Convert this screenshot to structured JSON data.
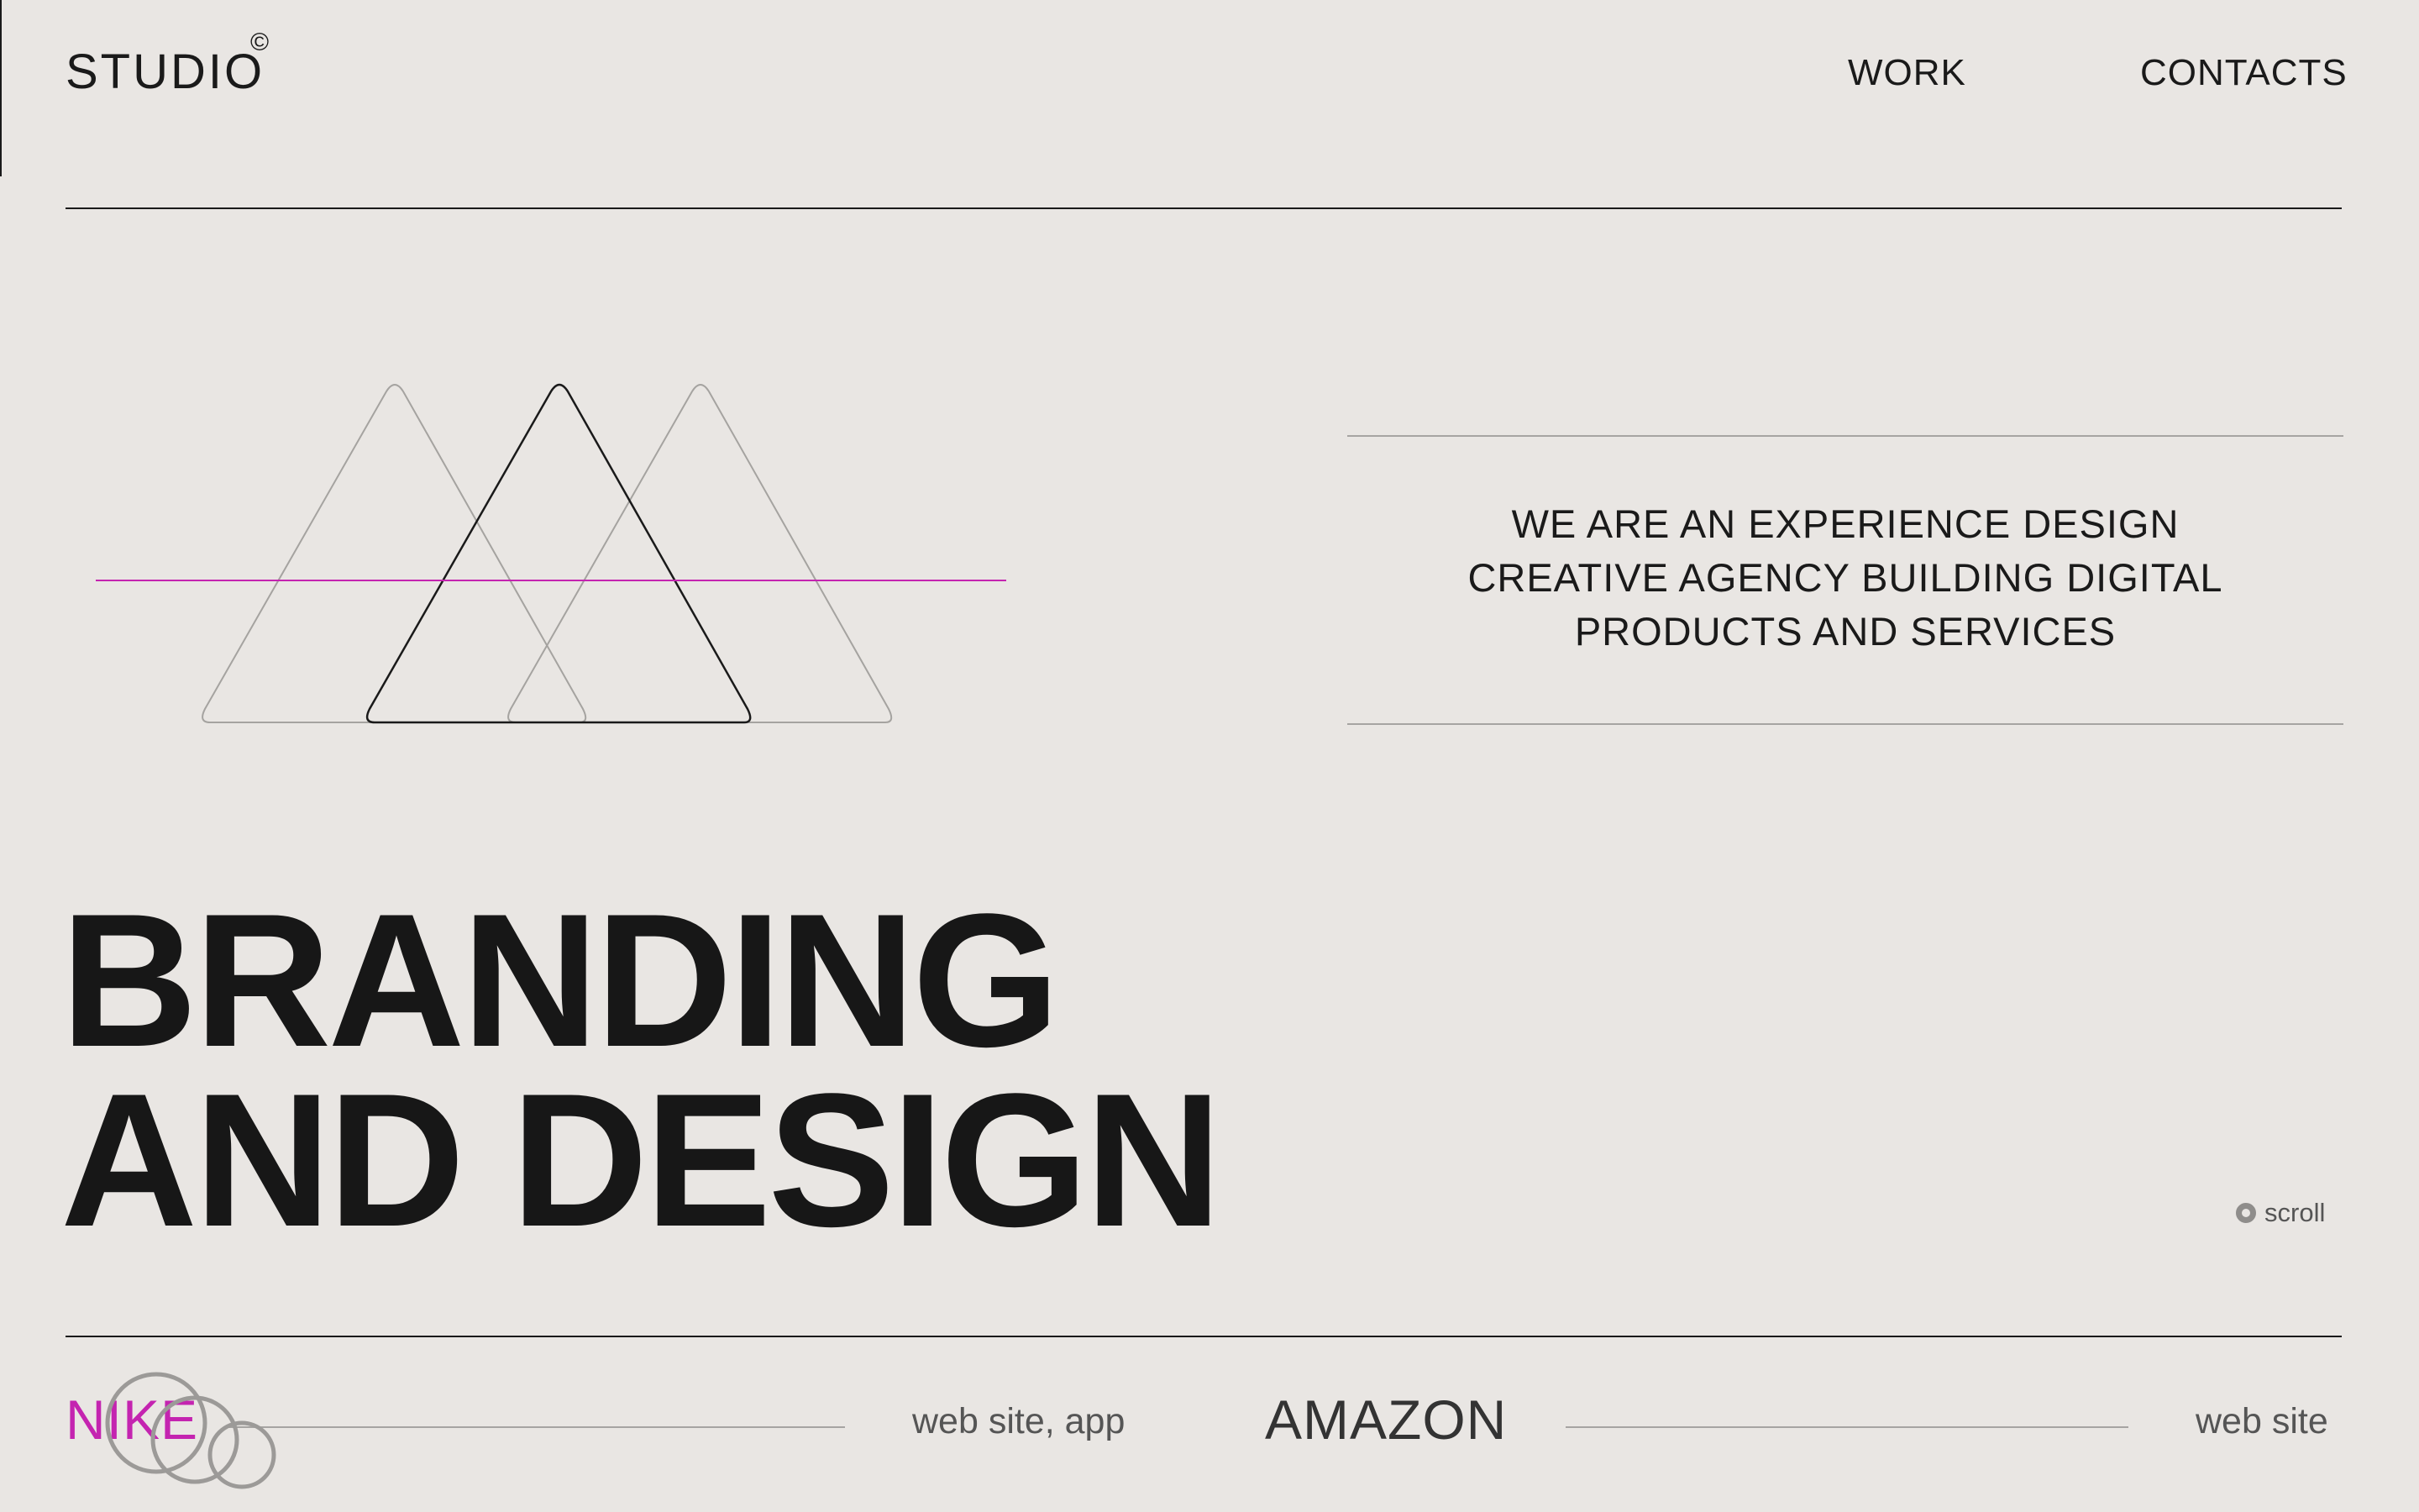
{
  "header": {
    "brand": "STUDIO",
    "brand_mark": "©",
    "nav": [
      {
        "label": "WORK"
      },
      {
        "label": "CONTACTS"
      }
    ]
  },
  "intro": {
    "tagline_lines": [
      "WE ARE AN EXPERIENCE DESIGN",
      "CREATIVE AGENCY BUILDING DIGITAL",
      "PRODUCTS AND SERVICES"
    ]
  },
  "hero": {
    "lines": [
      "BRANDING",
      "AND DESIGN"
    ]
  },
  "scroll": {
    "label": "scroll"
  },
  "projects": [
    {
      "name": "NIKE",
      "tags": "web site, app",
      "color": "#c424b0"
    },
    {
      "name": "AMAZON",
      "tags": "web site",
      "color": "#333333"
    }
  ],
  "colors": {
    "background": "#e9e6e3",
    "text": "#1a1a1a",
    "accent": "#c424b0",
    "muted_line": "#a6a4a2"
  },
  "icons": {
    "brand_mark": "copyright-icon",
    "scroll": "scroll-dot-icon",
    "illustration": "triangles-illustration",
    "cursor": "circles-cursor-icon"
  }
}
